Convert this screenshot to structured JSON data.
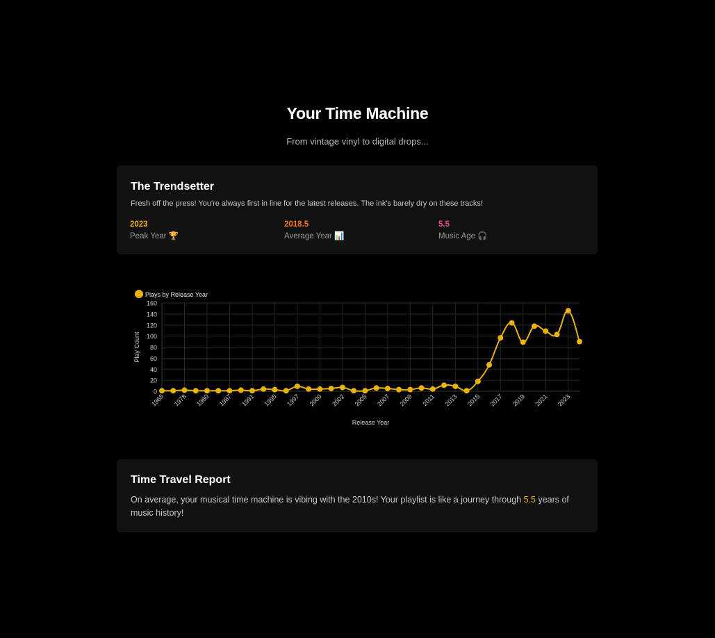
{
  "header": {
    "title": "Your Time Machine",
    "subtitle": "From vintage vinyl to digital drops..."
  },
  "profile_card": {
    "title": "The Trendsetter",
    "description": "Fresh off the press! You're always first in line for the latest releases. The ink's barely dry on these tracks!",
    "stats": [
      {
        "value": "2023",
        "label": "Peak Year 🏆",
        "color": "#eab308"
      },
      {
        "value": "2018.5",
        "label": "Average Year 📊",
        "color": "#f97316"
      },
      {
        "value": "5.5",
        "label": "Music Age 🎧",
        "color": "#ec4899"
      }
    ]
  },
  "chart_data": {
    "type": "line",
    "legend": "Plays by Release Year",
    "legend_position": "top-left",
    "xlabel": "Release Year",
    "ylabel": "Play Count",
    "ylim": [
      0,
      160
    ],
    "yticks": [
      0,
      20,
      40,
      60,
      80,
      100,
      120,
      140,
      160
    ],
    "grid": true,
    "color": "#eab308",
    "x": [
      "1965",
      "1976",
      "1978",
      "1979",
      "1980",
      "1986",
      "1987",
      "1990",
      "1991",
      "1994",
      "1995",
      "1996",
      "1997",
      "1999",
      "2000",
      "2001",
      "2002",
      "2004",
      "2005",
      "2006",
      "2007",
      "2008",
      "2009",
      "2010",
      "2011",
      "2012",
      "2013",
      "2014",
      "2015",
      "2016",
      "2017",
      "2018",
      "2019",
      "2020",
      "2021",
      "2022",
      "2023",
      "2024"
    ],
    "x_tick_labels_shown": [
      "1965",
      "1978",
      "1980",
      "1987",
      "1991",
      "1995",
      "1997",
      "2000",
      "2002",
      "2005",
      "2007",
      "2009",
      "2011",
      "2013",
      "2015",
      "2017",
      "2019",
      "2021",
      "2023"
    ],
    "values": [
      1,
      1,
      2,
      1,
      1,
      1,
      1,
      2,
      1,
      4,
      3,
      1,
      9,
      4,
      4,
      5,
      7,
      1,
      1,
      6,
      5,
      3,
      3,
      6,
      4,
      11,
      9,
      1,
      18,
      48,
      97,
      124,
      89,
      118,
      109,
      103,
      146,
      90
    ]
  },
  "report_card": {
    "title": "Time Travel Report",
    "text_before": "On average, your musical time machine is vibing with the 2010s! Your playlist is like a journey through ",
    "highlight": "5.5",
    "text_after": " years of music history!"
  }
}
